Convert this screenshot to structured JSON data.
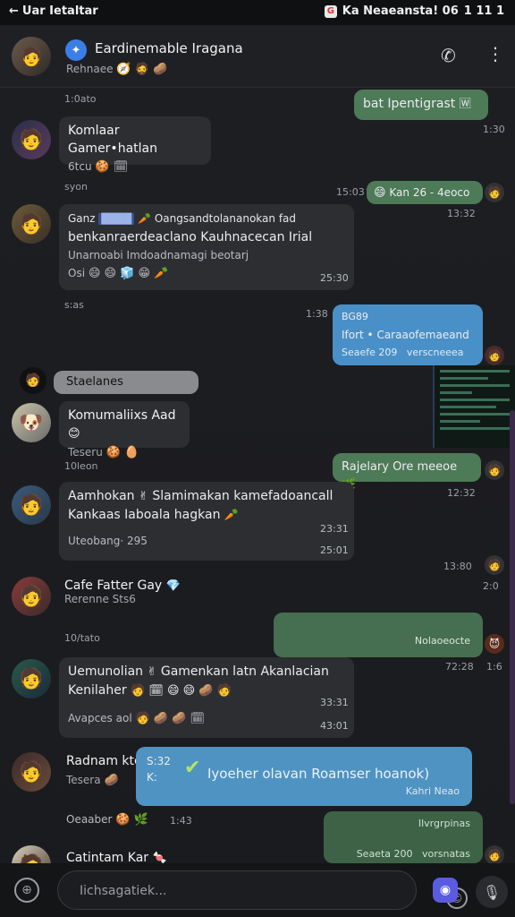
{
  "status_bar": {
    "left_text": "Uar Ietaltar",
    "right_text": "Ka Neaeansta! 06",
    "signal": "1 11 1"
  },
  "header": {
    "title": "Eardinemable Iragana",
    "subtitle": "Rehnaee",
    "call_icon": "phone-icon",
    "more_icon": "more-vert-icon"
  },
  "feed": {
    "timestamps": [
      "1:0ato",
      "syon",
      "s:as",
      "10leon",
      "10/tato"
    ],
    "messages": [
      {
        "name": "Komlaar Gamer•hatlan",
        "text": "6tcu",
        "time": "1:30"
      },
      {
        "out_text": "bat Ipentigrast",
        "time": "1:30"
      },
      {
        "out_text": "Kan 26 - 4eoco",
        "time_left": "15:03",
        "time": "13:32"
      },
      {
        "header": "Ganz",
        "line1": "Oangsandtolananokan fad",
        "line2": "benkanraerdeaclano Kauhnacecan Irial",
        "line3": "Unarnoabi Imdoadnamagi beotarj",
        "footer": "Osi",
        "time": "25:30"
      },
      {
        "out_title": "BG89",
        "out_text": "Ifort • Caraaofemaeand",
        "out_meta": "Seaefe 209",
        "out_meta2": "verscneeea",
        "time_left": "1:38"
      },
      {
        "label": "Staelanes"
      },
      {
        "name": "Komumaliixs Aad",
        "sub": "Teseru"
      },
      {
        "out_text": "Rajelary Ore meeoe",
        "time": "12:32"
      },
      {
        "line1": "Aamhokan",
        "line1b": "Slamimakan kamefadoancall",
        "line2": "Kankaas Iaboala hagkan",
        "footer": "Uteobang· 295",
        "time": "23:31",
        "time2": "25:01",
        "side_time": "13:80"
      },
      {
        "name": "Cafe Fatter Gay",
        "sub": "Rerenne Sts6",
        "side_time": "2:0"
      },
      {
        "out_meta": "Nolaoeocte",
        "time": "72:28",
        "time2": "1:6"
      },
      {
        "line1": "Uemunolian",
        "line1b": "Gamenkan latn Akanlacian",
        "line2": "Kenilaher",
        "footer": "Avapces aol",
        "time": "33:31",
        "time2": "43:01"
      },
      {
        "name": "Radnam ktc",
        "code": "S:32",
        "code2": "K:",
        "sub": "Tesera",
        "blue_text": "Iyoeher olavan Roamser hoanok)",
        "blue_meta": "Kahri Neao",
        "footer": "Oeaaber",
        "time": "1:43"
      },
      {
        "out_meta": "Ilvrgrpinas",
        "out_meta2": "Seaeta 200",
        "out_meta3": "vorsnatas"
      },
      {
        "name": "Catintam Kar"
      }
    ]
  },
  "composer": {
    "placeholder": "Iichsagatiek..."
  },
  "colors": {
    "accent": "#3a7ee8",
    "outgoing": "#4d7a57",
    "incoming": "#2d2e32",
    "blue_bubble": "#4a90c8"
  }
}
